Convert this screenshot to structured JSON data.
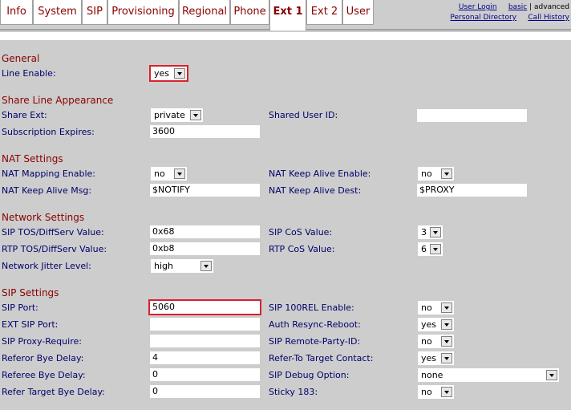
{
  "tabs": [
    {
      "label": "Info"
    },
    {
      "label": "System"
    },
    {
      "label": "SIP"
    },
    {
      "label": "Provisioning"
    },
    {
      "label": "Regional"
    },
    {
      "label": "Phone"
    },
    {
      "label": "Ext 1"
    },
    {
      "label": "Ext 2"
    },
    {
      "label": "User"
    }
  ],
  "active_tab": "Ext 1",
  "top_links": {
    "user_login": "User Login",
    "basic": "basic",
    "separator": "|",
    "advanced": "advanced",
    "personal_directory": "Personal Directory",
    "call_history": "Call History"
  },
  "sections": {
    "general": "General",
    "share_line": "Share Line Appearance",
    "nat": "NAT Settings",
    "network": "Network Settings",
    "sip": "SIP Settings"
  },
  "fields": {
    "line_enable": {
      "label": "Line Enable:",
      "value": "yes"
    },
    "share_ext": {
      "label": "Share Ext:",
      "value": "private"
    },
    "shared_user_id": {
      "label": "Shared User ID:",
      "value": ""
    },
    "subscription_expires": {
      "label": "Subscription Expires:",
      "value": "3600"
    },
    "nat_mapping_enable": {
      "label": "NAT Mapping Enable:",
      "value": "no"
    },
    "nat_keep_alive_enable": {
      "label": "NAT Keep Alive Enable:",
      "value": "no"
    },
    "nat_keep_alive_msg": {
      "label": "NAT Keep Alive Msg:",
      "value": "$NOTIFY"
    },
    "nat_keep_alive_dest": {
      "label": "NAT Keep Alive Dest:",
      "value": "$PROXY"
    },
    "sip_tos": {
      "label": "SIP TOS/DiffServ Value:",
      "value": "0x68"
    },
    "sip_cos": {
      "label": "SIP CoS Value:",
      "value": "3"
    },
    "rtp_tos": {
      "label": "RTP TOS/DiffServ Value:",
      "value": "0xb8"
    },
    "rtp_cos": {
      "label": "RTP CoS Value:",
      "value": "6"
    },
    "network_jitter": {
      "label": "Network Jitter Level:",
      "value": "high"
    },
    "sip_port": {
      "label": "SIP Port:",
      "value": "5060"
    },
    "sip_100rel": {
      "label": "SIP 100REL Enable:",
      "value": "no"
    },
    "ext_sip_port": {
      "label": "EXT SIP Port:",
      "value": ""
    },
    "auth_resync": {
      "label": "Auth Resync-Reboot:",
      "value": "yes"
    },
    "sip_proxy_require": {
      "label": "SIP Proxy-Require:",
      "value": ""
    },
    "sip_remote_party": {
      "label": "SIP Remote-Party-ID:",
      "value": "no"
    },
    "referor_bye_delay": {
      "label": "Referor Bye Delay:",
      "value": "4"
    },
    "refer_to_target": {
      "label": "Refer-To Target Contact:",
      "value": "yes"
    },
    "referee_bye_delay": {
      "label": "Referee Bye Delay:",
      "value": "0"
    },
    "sip_debug": {
      "label": "SIP Debug Option:",
      "value": "none"
    },
    "refer_target_bye_delay": {
      "label": "Refer Target Bye Delay:",
      "value": "0"
    },
    "sticky_183": {
      "label": "Sticky 183:",
      "value": "no"
    }
  },
  "colors": {
    "tab_text": "#8b0000",
    "section_text": "#8b0000",
    "label_text": "#00006b",
    "highlight": "#d9212c",
    "background": "#cdcdcd"
  }
}
